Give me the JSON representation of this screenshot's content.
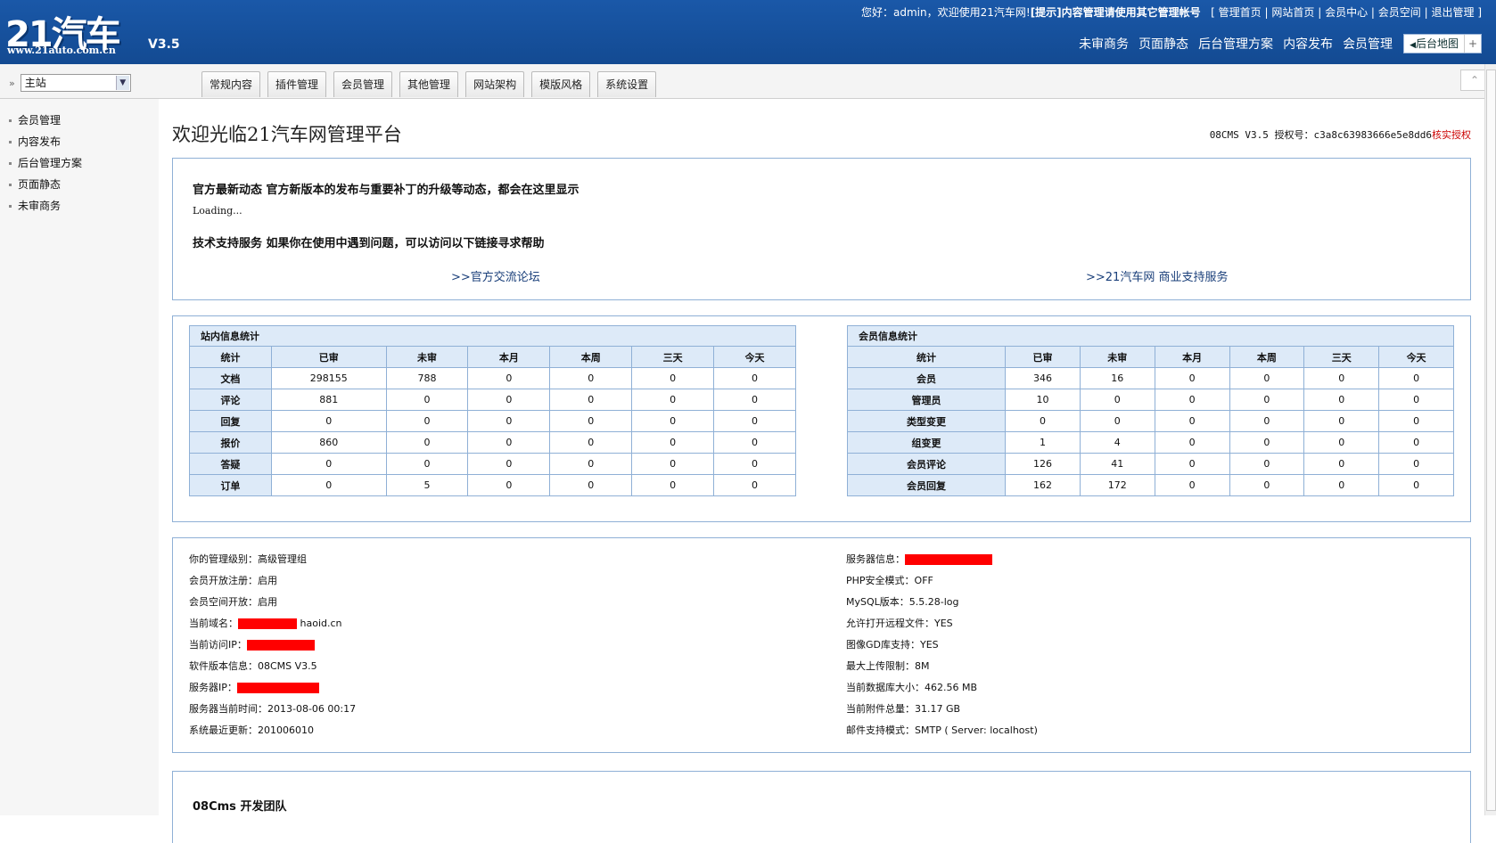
{
  "header": {
    "logo_text": "21汽车网",
    "logo_url": "www.21auto.com.cn",
    "version": "V3.5",
    "welcome_prefix": "您好：admin，欢迎使用21汽车网!",
    "welcome_tip": "[提示]内容管理请使用其它管理帐号",
    "links": [
      "[ 管理首页",
      "|",
      "网站首页",
      "|",
      "会员中心",
      "|",
      "会员空间",
      "|",
      "退出管理 ]"
    ],
    "nav": [
      "未审商务",
      "页面静态",
      "后台管理方案",
      "内容发布",
      "会员管理"
    ],
    "map_label": "后台地图",
    "map_plus": "+"
  },
  "site_select": {
    "value": "主站"
  },
  "tabs": [
    "常规内容",
    "插件管理",
    "会员管理",
    "其他管理",
    "网站架构",
    "模版风格",
    "系统设置"
  ],
  "sidebar": [
    "会员管理",
    "内容发布",
    "后台管理方案",
    "页面静态",
    "未审商务"
  ],
  "main": {
    "title": "欢迎光临21汽车网管理平台",
    "license_prefix": "08CMS V3.5  授权号：c3a8c63983666e5e8dd6",
    "license_status": "核实授权",
    "news_heading": "官方最新动态  官方新版本的发布与重要补丁的升级等动态，都会在这里显示",
    "loading": "Loading...",
    "support_heading": "技术支持服务  如果你在使用中遇到问题，可以访问以下链接寻求帮助",
    "link_forum": ">>官方交流论坛",
    "link_business": ">>21汽车网 商业支持服务"
  },
  "site_stats": {
    "caption": "站内信息统计",
    "columns": [
      "统计",
      "已审",
      "未审",
      "本月",
      "本周",
      "三天",
      "今天"
    ],
    "rows": [
      [
        "文档",
        "298155",
        "788",
        "0",
        "0",
        "0",
        "0"
      ],
      [
        "评论",
        "881",
        "0",
        "0",
        "0",
        "0",
        "0"
      ],
      [
        "回复",
        "0",
        "0",
        "0",
        "0",
        "0",
        "0"
      ],
      [
        "报价",
        "860",
        "0",
        "0",
        "0",
        "0",
        "0"
      ],
      [
        "答疑",
        "0",
        "0",
        "0",
        "0",
        "0",
        "0"
      ],
      [
        "订单",
        "0",
        "5",
        "0",
        "0",
        "0",
        "0"
      ]
    ]
  },
  "member_stats": {
    "caption": "会员信息统计",
    "columns": [
      "统计",
      "已审",
      "未审",
      "本月",
      "本周",
      "三天",
      "今天"
    ],
    "rows": [
      [
        "会员",
        "346",
        "16",
        "0",
        "0",
        "0",
        "0"
      ],
      [
        "管理员",
        "10",
        "0",
        "0",
        "0",
        "0",
        "0"
      ],
      [
        "类型变更",
        "0",
        "0",
        "0",
        "0",
        "0",
        "0"
      ],
      [
        "组变更",
        "1",
        "4",
        "0",
        "0",
        "0",
        "0"
      ],
      [
        "会员评论",
        "126",
        "41",
        "0",
        "0",
        "0",
        "0"
      ],
      [
        "会员回复",
        "162",
        "172",
        "0",
        "0",
        "0",
        "0"
      ]
    ]
  },
  "sys_left": [
    "你的管理级别：高级管理组",
    "会员开放注册：启用",
    "会员空间开放：启用",
    "当前域名：",
    "当前访问IP：",
    "软件版本信息：08CMS V3.5",
    "服务器IP：",
    "服务器当前时间：2013-08-06 00:17",
    "系统最近更新：201006010"
  ],
  "domain_suffix": "haoid.cn",
  "sys_right": [
    "服务器信息：",
    "PHP安全模式：OFF",
    "MySQL版本：5.5.28-log",
    "允许打开远程文件：YES",
    "图像GD库支持：YES",
    "最大上传限制：8M",
    "当前数据库大小：462.56 MB",
    "当前附件总量：31.17 GB",
    "邮件支持模式：SMTP  ( Server: localhost)"
  ],
  "team": "08Cms  开发团队",
  "colors": {
    "header_blue": "#1a58a8",
    "border_blue": "#8fb0d6",
    "cell_blue": "#ddeaf8",
    "redact": "#ff0000"
  }
}
